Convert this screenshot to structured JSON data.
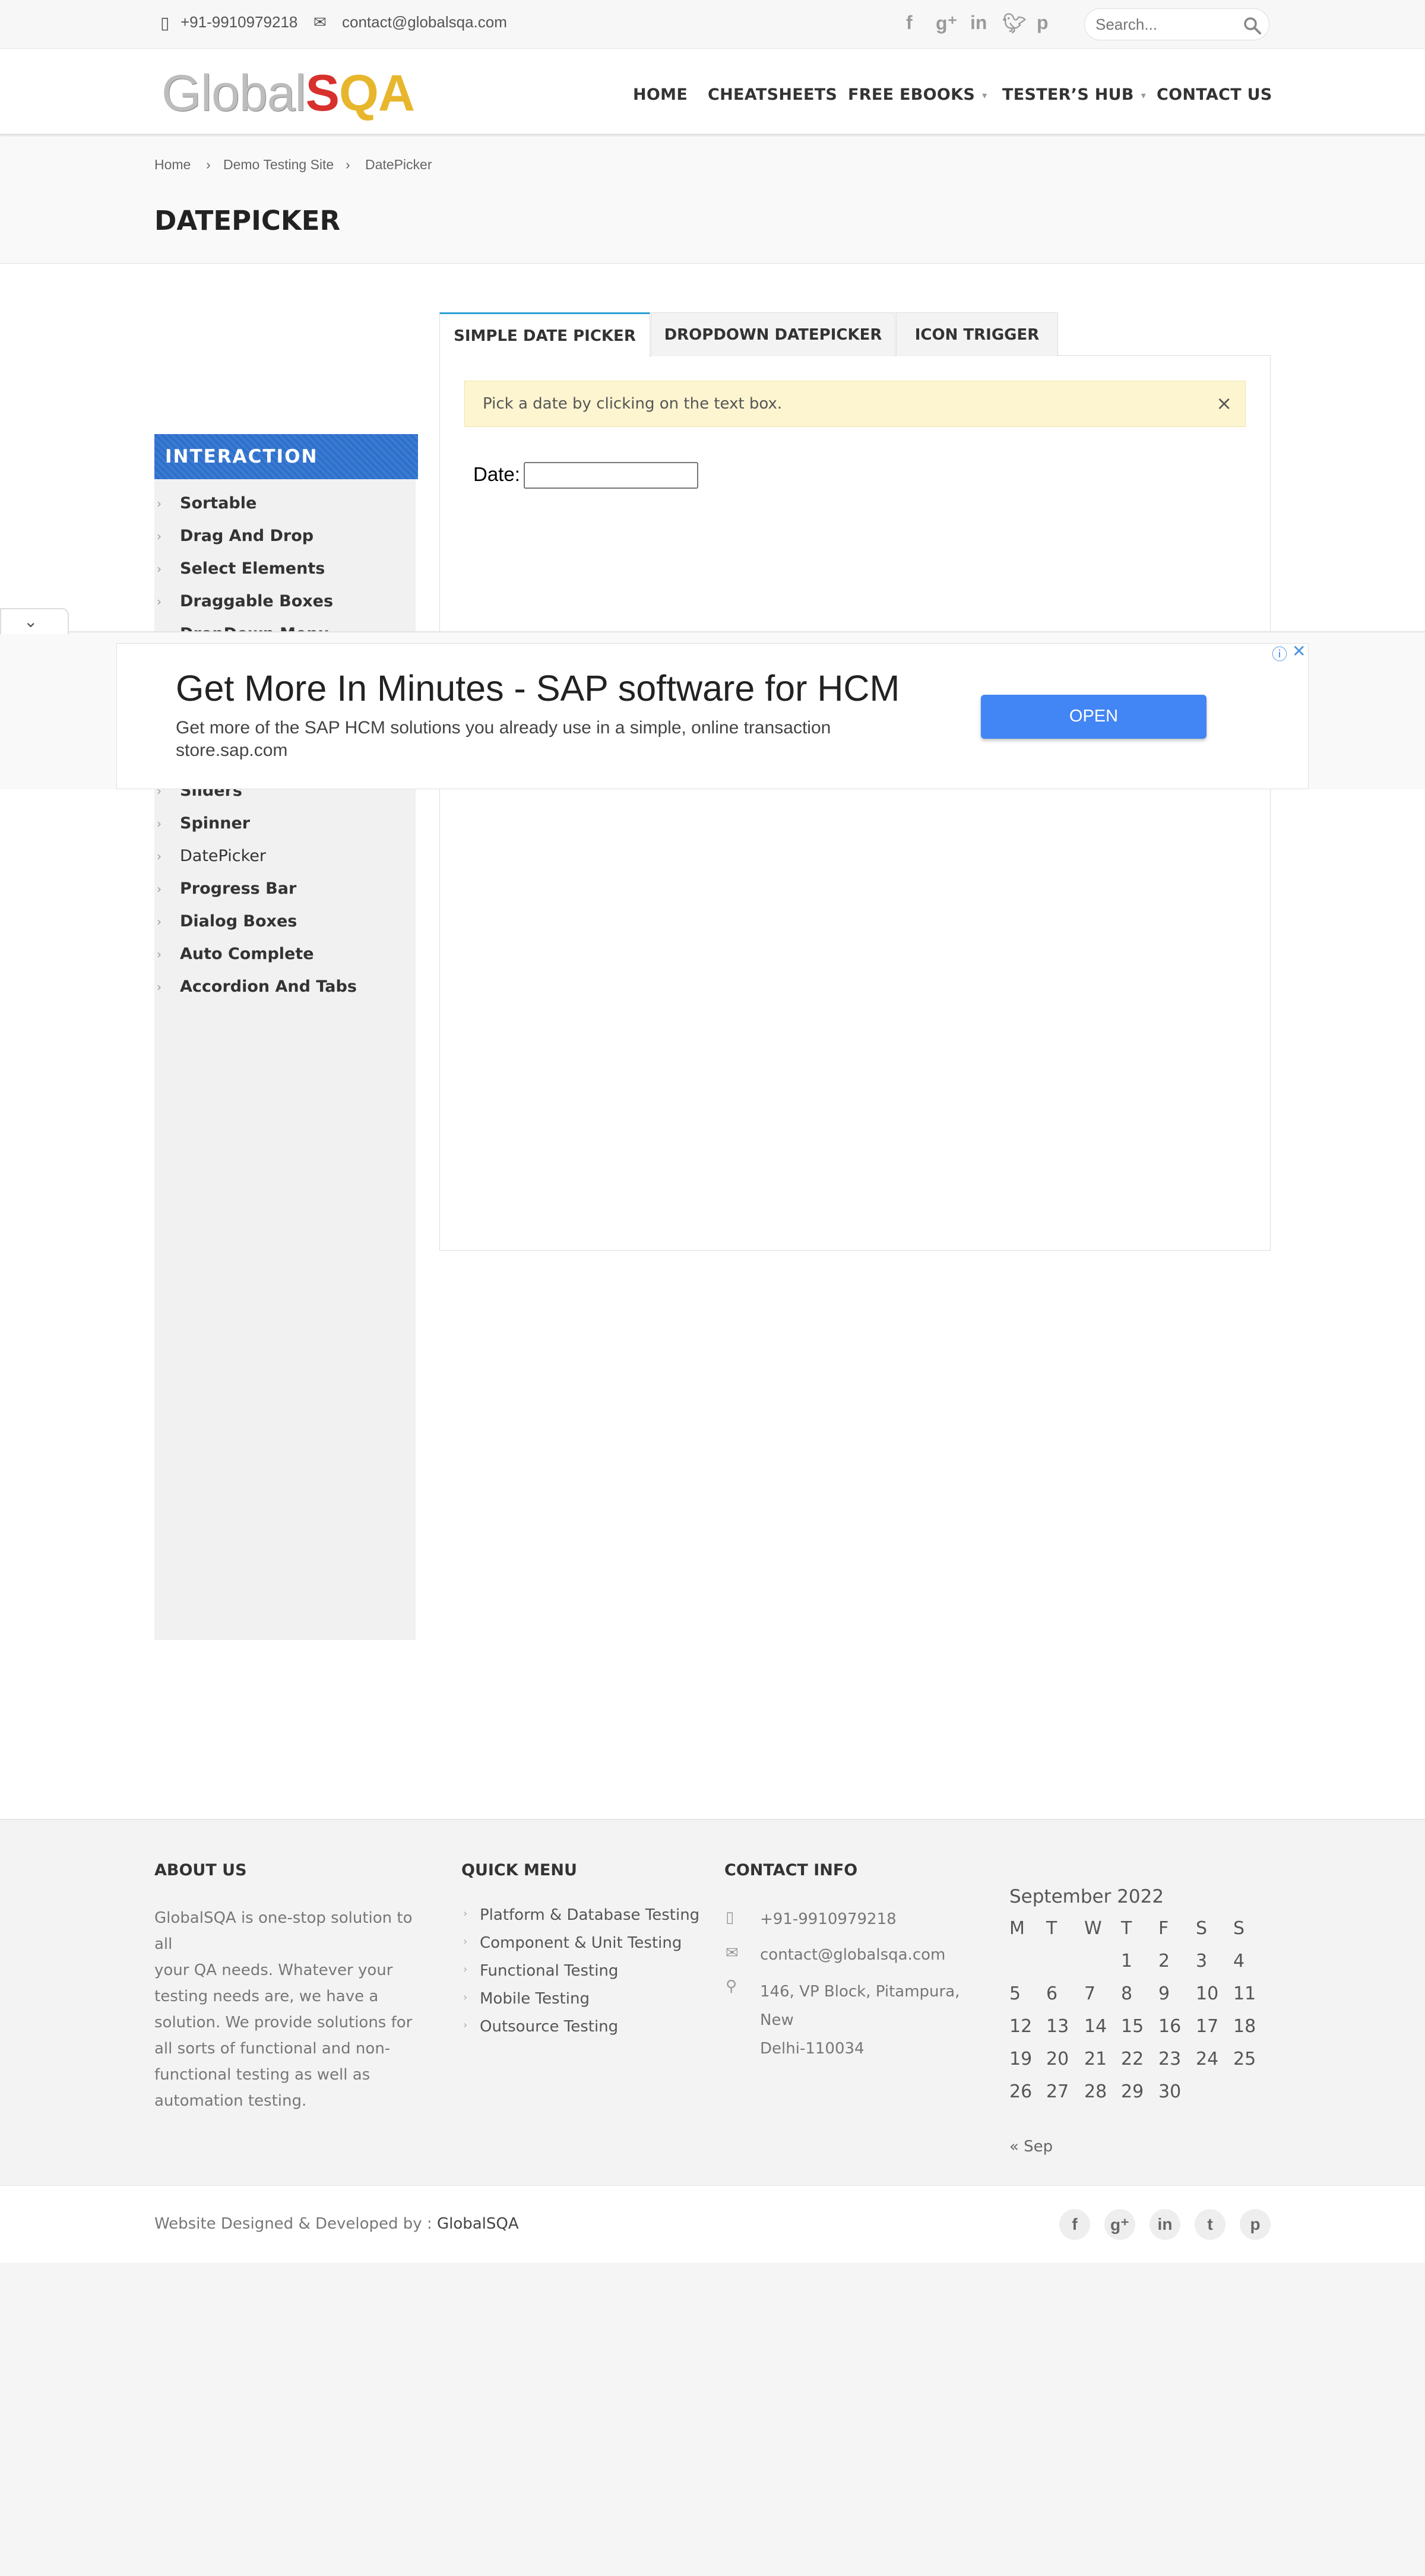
{
  "topbar": {
    "phone": "+91-9910979218",
    "email": "contact@globalsqa.com",
    "social_icons": [
      "facebook-icon",
      "google-plus-icon",
      "linkedin-icon",
      "twitter-icon",
      "pinterest-icon"
    ],
    "search_placeholder": "Search..."
  },
  "header": {
    "logo": {
      "part1": "Global",
      "part2": "S",
      "part3": "QA"
    },
    "nav": {
      "home": "HOME",
      "cheatsheets": "CHEATSHEETS",
      "ebooks": "FREE EBOOKS",
      "testers_hub": "TESTER’S HUB",
      "contact": "CONTACT US"
    }
  },
  "breadcrumb": [
    "Home",
    "Demo Testing Site",
    "DatePicker"
  ],
  "page_title": "DATEPICKER",
  "sidebar": {
    "heading": "INTERACTION",
    "items_top": [
      "Sortable",
      "Drag And Drop",
      "Select Elements",
      "Draggable Boxes",
      "DropDown Menu"
    ],
    "items_bottom": [
      "Sliders",
      "Spinner",
      "DatePicker",
      "Progress Bar",
      "Dialog Boxes",
      "Auto Complete",
      "Accordion And Tabs"
    ]
  },
  "tabs": [
    "SIMPLE DATE PICKER",
    "DROPDOWN DATEPICKER",
    "ICON TRIGGER"
  ],
  "panel": {
    "alert": "Pick a date by clicking on the text box.",
    "alert_close": "×",
    "date_label": "Date:",
    "date_value": ""
  },
  "ad": {
    "title": "Get More In Minutes - SAP software for HCM",
    "description": "Get more of the SAP HCM solutions you already use in a simple, online transaction",
    "url": "store.sap.com",
    "button": "OPEN"
  },
  "footer": {
    "about_heading": "ABOUT US",
    "about_text": [
      "GlobalSQA is one-stop solution to all",
      "your QA needs. Whatever your",
      "testing needs are, we have a",
      "solution. We provide solutions for",
      "all sorts of functional and non-",
      "functional testing as well as",
      "automation testing."
    ],
    "quick_heading": "QUICK MENU",
    "quick_links": [
      "Platform & Database Testing",
      "Component & Unit Testing",
      "Functional Testing",
      "Mobile Testing",
      "Outsource Testing"
    ],
    "contact_heading": "CONTACT INFO",
    "contact_phone": "+91-9910979218",
    "contact_email": "contact@globalsqa.com",
    "contact_address": [
      "146, VP Block, Pitampura, New",
      "Delhi-110034"
    ],
    "calendar": {
      "caption": "September 2022",
      "weekdays": [
        "M",
        "T",
        "W",
        "T",
        "F",
        "S",
        "S"
      ],
      "weeks": [
        [
          "",
          "",
          "",
          "1",
          "2",
          "3",
          "4"
        ],
        [
          "5",
          "6",
          "7",
          "8",
          "9",
          "10",
          "11"
        ],
        [
          "12",
          "13",
          "14",
          "15",
          "16",
          "17",
          "18"
        ],
        [
          "19",
          "20",
          "21",
          "22",
          "23",
          "24",
          "25"
        ],
        [
          "26",
          "27",
          "28",
          "29",
          "30",
          "",
          ""
        ]
      ],
      "prev": "« Sep"
    }
  },
  "bottombar": {
    "credit_prefix": "Website Designed & Developed by : ",
    "credit_name": "GlobalSQA"
  }
}
